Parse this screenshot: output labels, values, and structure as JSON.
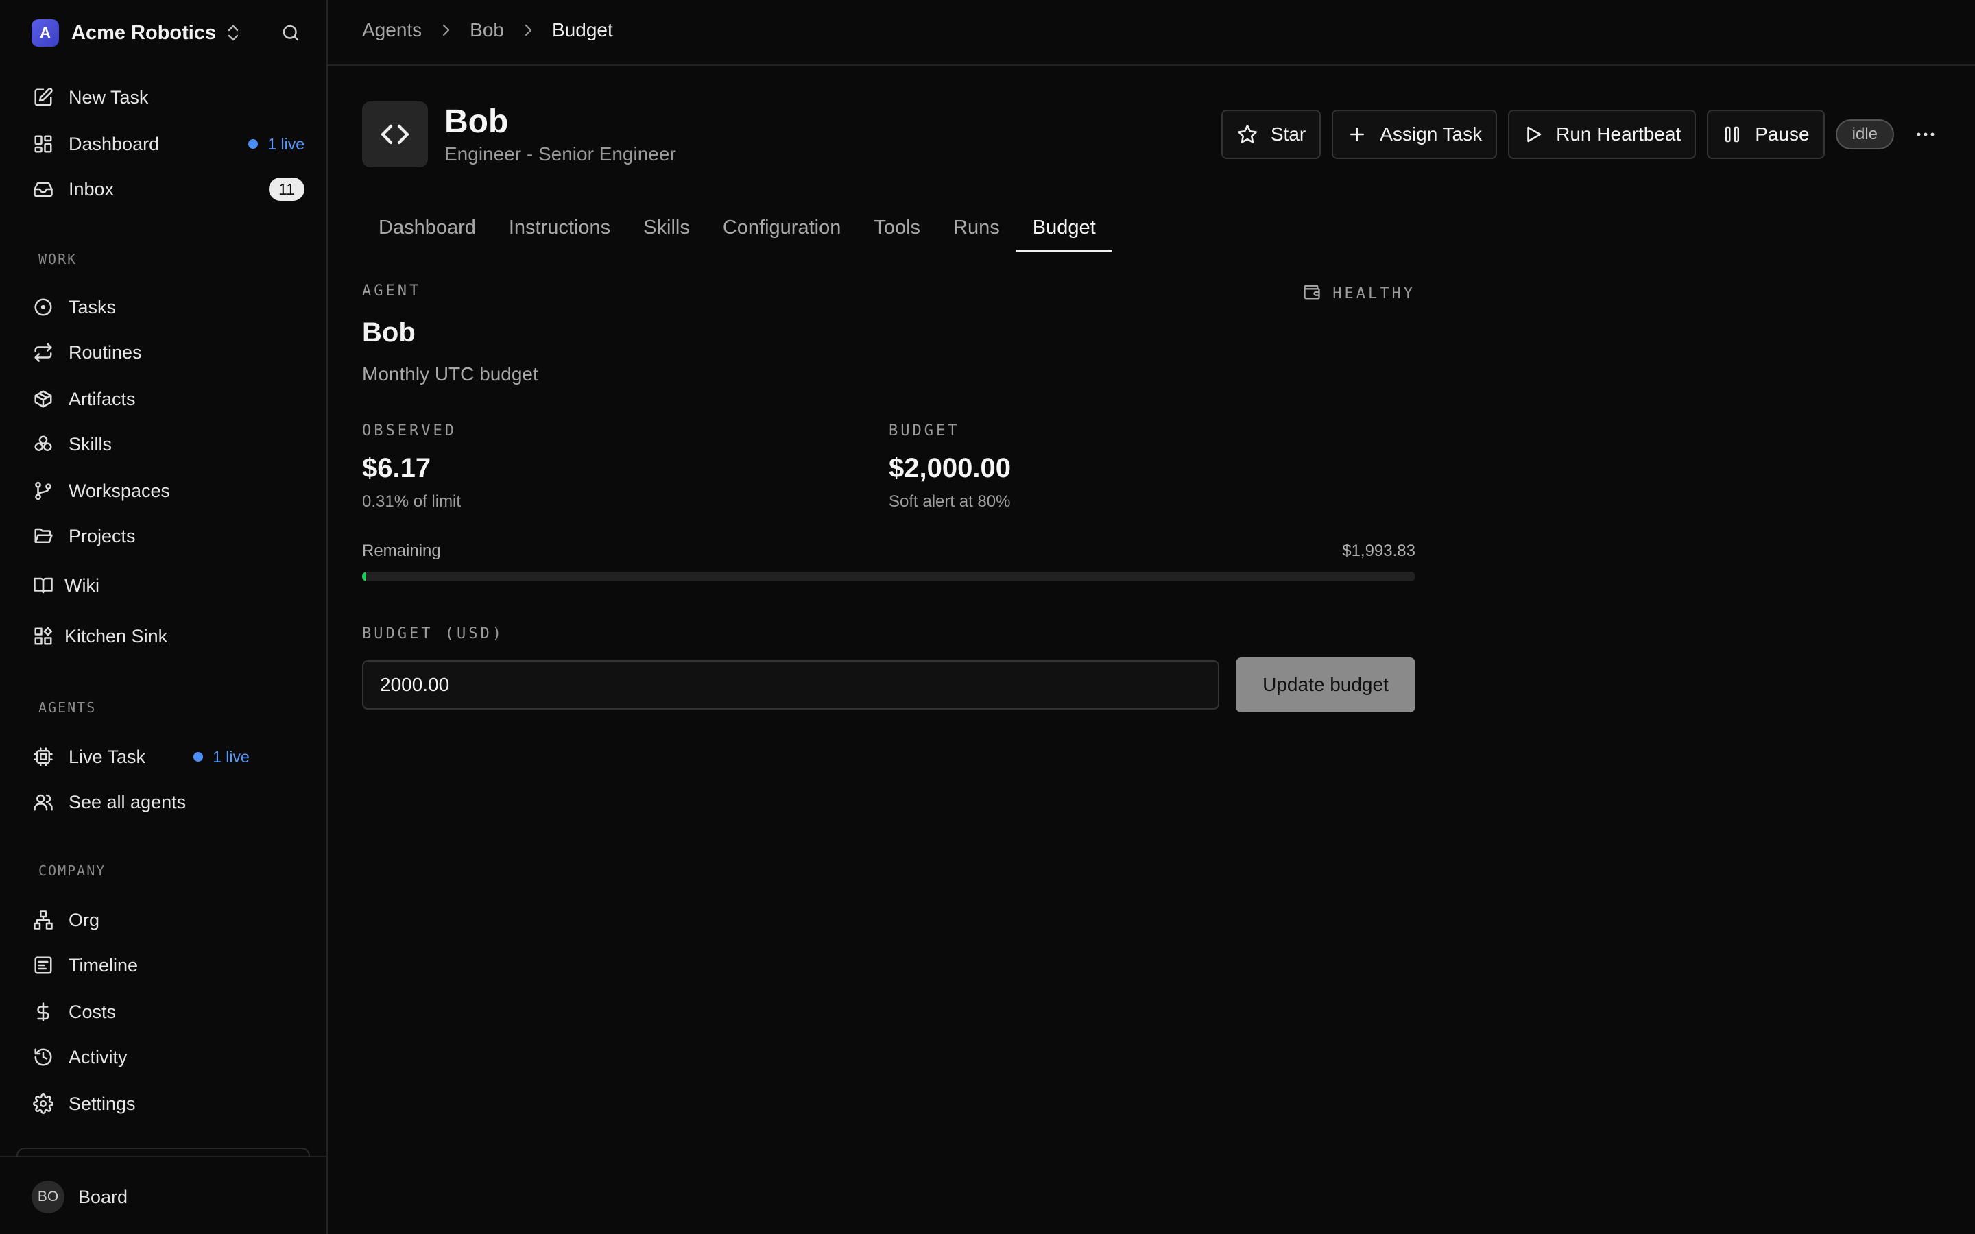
{
  "company": {
    "name": "Acme Robotics",
    "logo_letter": "A",
    "logo_color": "#4f53e0"
  },
  "sidebar": {
    "top": [
      {
        "label": "New Task",
        "icon": "edit-icon"
      },
      {
        "label": "Dashboard",
        "icon": "dashboard-icon",
        "live": "1 live"
      },
      {
        "label": "Inbox",
        "icon": "inbox-icon",
        "badge": "11"
      }
    ],
    "work_title": "WORK",
    "work": [
      {
        "label": "Tasks",
        "icon": "circle-dot-icon"
      },
      {
        "label": "Routines",
        "icon": "repeat-icon"
      },
      {
        "label": "Artifacts",
        "icon": "package-icon"
      },
      {
        "label": "Skills",
        "icon": "boxes-icon"
      },
      {
        "label": "Workspaces",
        "icon": "git-branch-icon"
      },
      {
        "label": "Projects",
        "icon": "folder-open-icon"
      },
      {
        "label": "Wiki",
        "icon": "book-icon"
      },
      {
        "label": "Kitchen Sink",
        "icon": "widgets-icon"
      }
    ],
    "agents_title": "AGENTS",
    "agents": [
      {
        "label": "Live Task",
        "icon": "cpu-icon",
        "live": "1 live"
      },
      {
        "label": "See all agents",
        "icon": "users-icon"
      }
    ],
    "company_title": "COMPANY",
    "company_items": [
      {
        "label": "Org",
        "icon": "network-icon"
      },
      {
        "label": "Timeline",
        "icon": "timeline-icon"
      },
      {
        "label": "Costs",
        "icon": "dollar-icon"
      },
      {
        "label": "Activity",
        "icon": "history-icon"
      },
      {
        "label": "Settings",
        "icon": "gear-icon"
      }
    ],
    "footer": {
      "initials": "BO",
      "label": "Board"
    }
  },
  "breadcrumb": [
    "Agents",
    "Bob",
    "Budget"
  ],
  "agent": {
    "name": "Bob",
    "role": "Engineer - Senior Engineer",
    "status": "idle"
  },
  "actions": {
    "star": "Star",
    "assign": "Assign Task",
    "heartbeat": "Run Heartbeat",
    "pause": "Pause"
  },
  "tabs": [
    "Dashboard",
    "Instructions",
    "Skills",
    "Configuration",
    "Tools",
    "Runs",
    "Budget"
  ],
  "active_tab": "Budget",
  "budget": {
    "eyebrow": "AGENT",
    "health": "HEALTHY",
    "name": "Bob",
    "period": "Monthly UTC budget",
    "observed_label": "OBSERVED",
    "observed_value": "$6.17",
    "observed_sub": "0.31% of limit",
    "budget_label": "BUDGET",
    "budget_value": "$2,000.00",
    "budget_sub": "Soft alert at 80%",
    "remaining_label": "Remaining",
    "remaining_value": "$1,993.83",
    "used_fraction": 0.0031,
    "input_label": "BUDGET (USD)",
    "input_value": "2000.00",
    "update_label": "Update budget"
  },
  "colors": {
    "accent_live": "#4b8ff7",
    "progress": "#22c55e",
    "background": "#0a0a0a"
  }
}
